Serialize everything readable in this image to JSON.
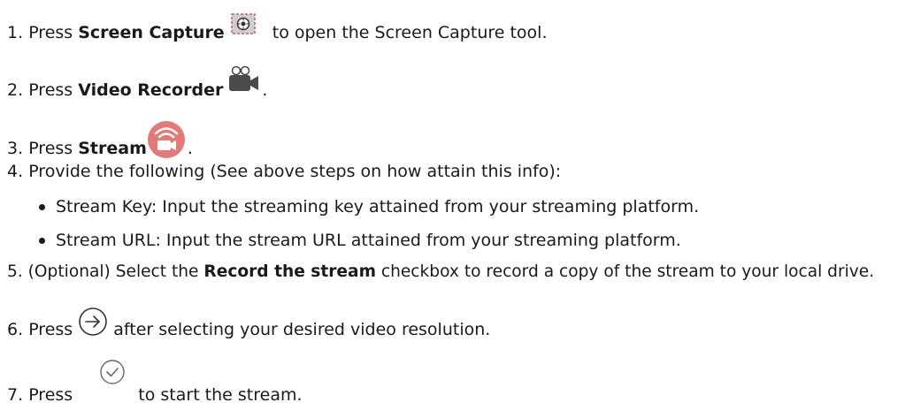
{
  "steps": [
    {
      "number": "1.",
      "pre": "Press ",
      "bold": "Screen Capture",
      "post": " to open the Screen Capture tool.",
      "icon": "screen-capture-icon"
    },
    {
      "number": "2.",
      "pre": "Press ",
      "bold": "Video Recorder",
      "post": ".",
      "icon": "video-recorder-icon"
    },
    {
      "number": "3.",
      "pre": "Press ",
      "bold": "Stream",
      "post": ".",
      "icon": "stream-icon"
    },
    {
      "number": "4.",
      "text": "Provide the following (See above steps on how attain this info):"
    },
    {
      "number": "5.",
      "pre": "(Optional) Select the ",
      "bold": "Record the stream",
      "post": " checkbox to record a copy of the stream to your local drive."
    },
    {
      "number": "6.",
      "pre": "Press ",
      "post": " after selecting your desired video resolution.",
      "icon": "next-arrow-icon"
    },
    {
      "number": "7.",
      "pre": "Press ",
      "post": " to start the stream.",
      "icon": "checkmark-icon"
    }
  ],
  "bullets": [
    "Stream Key: Input the streaming key attained from your streaming platform.",
    "Stream URL: Input the stream URL attained from your streaming platform."
  ],
  "colors": {
    "text": "#1a1a1a",
    "stream_icon": "#e37a7a",
    "icon_gray": "#555555"
  }
}
